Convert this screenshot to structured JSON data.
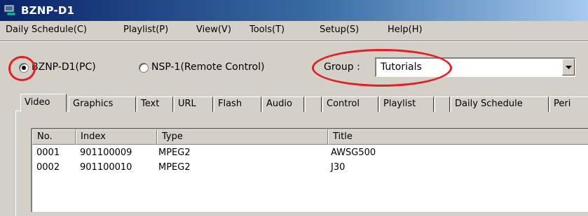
{
  "window": {
    "title": "BZNP-D1"
  },
  "menu": [
    "Daily Schedule(C)",
    "Playlist(P)",
    "View(V)",
    "Tools(T)",
    "Setup(S)",
    "Help(H)"
  ],
  "mode": {
    "options": [
      {
        "label": "BZNP-D1(PC)",
        "selected": true
      },
      {
        "label": "NSP-1(Remote Control)",
        "selected": false
      }
    ]
  },
  "group": {
    "label": "Group :",
    "value": "Tutorials"
  },
  "tabs": [
    "Video",
    "Graphics",
    "Text",
    "URL",
    "Flash",
    "Audio",
    "",
    "Control",
    "Playlist",
    "",
    "Daily Schedule",
    "Peri"
  ],
  "active_tab": "Video",
  "table": {
    "columns": [
      "No.",
      "Index",
      "Type",
      "Title"
    ],
    "rows": [
      [
        "0001",
        "901100009",
        "MPEG2",
        "AWSG500"
      ],
      [
        "0002",
        "901100010",
        "MPEG2",
        "J30"
      ]
    ]
  },
  "colors": {
    "annotation": "#e31e24",
    "titlebar": "#0a246a"
  }
}
